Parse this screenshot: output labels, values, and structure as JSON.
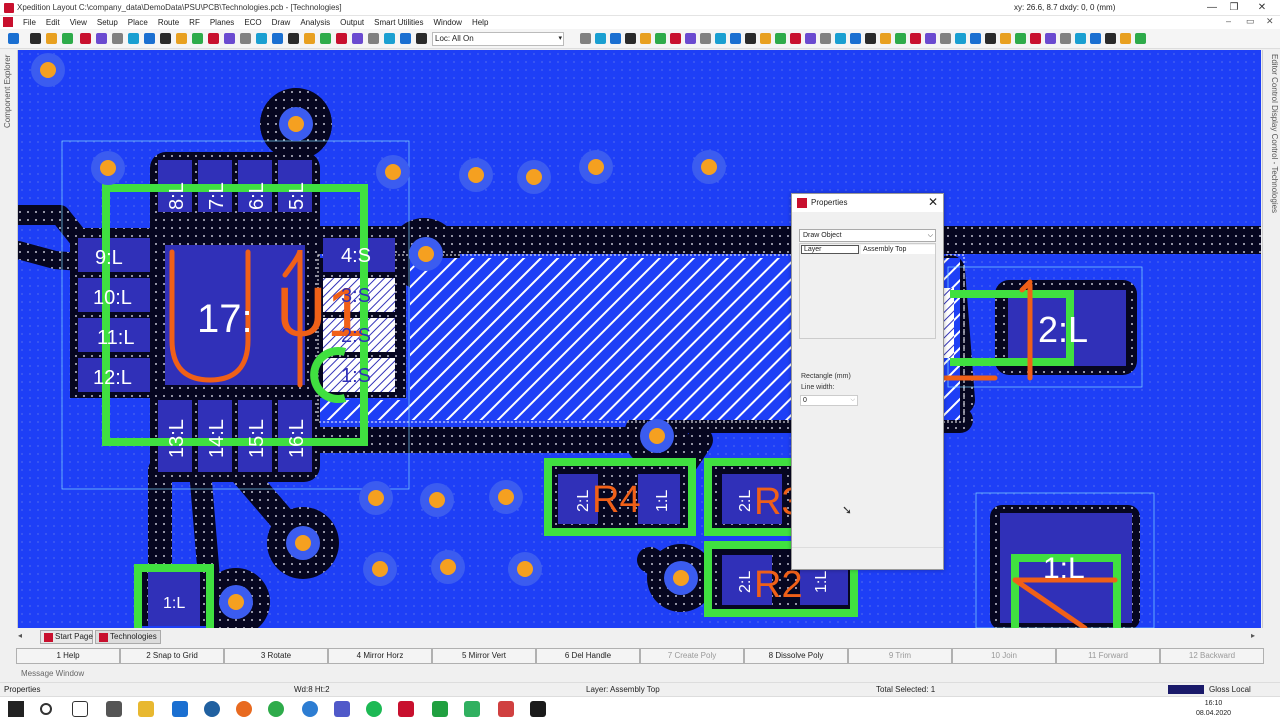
{
  "window": {
    "title": "Xpedition Layout  C:\\company_data\\DemoData\\PSU\\PCB\\Technologies.pcb - [Technologies]",
    "coords": "xy: 26.6, 8.7  dxdy: 0, 0  (mm)",
    "min": "—",
    "max": "❐",
    "close": "✕"
  },
  "menu": [
    "File",
    "Edit",
    "View",
    "Setup",
    "Place",
    "Route",
    "RF",
    "Planes",
    "ECO",
    "Draw",
    "Analysis",
    "Output",
    "Smart Utilities",
    "Window",
    "Help"
  ],
  "mdi": {
    "min": "–",
    "max": "▭",
    "close": "✕"
  },
  "toolbar": {
    "layer_filter": "Loc: All On",
    "arrow": "▾"
  },
  "side": {
    "left": "Component Explorer",
    "right": "Editor Control  Display Control - Technologies"
  },
  "pcb": {
    "components": [
      "17:",
      "U1",
      "8:L",
      "7:L",
      "6:L",
      "5:L",
      "9:L",
      "10:L",
      "11:L",
      "12:L",
      "13:L",
      "14:L",
      "15:L",
      "16:L",
      "4:S",
      "3:S",
      "2:S",
      "1:S",
      "2:L",
      "R4",
      "1:L",
      "2:L",
      "R3",
      "2:L",
      "R2",
      "1:L",
      "2:L",
      "1:L",
      "1:L"
    ]
  },
  "properties": {
    "title": "Properties",
    "close": "✕",
    "object": "Draw Object",
    "arrow": "⌵",
    "row_key": "Layer",
    "row_val": "Assembly Top",
    "section": "Rectangle (mm)",
    "lw_label": "Line width:",
    "lw_val": "0"
  },
  "tabs": {
    "left": "◂",
    "right": "▸",
    "items": [
      "Start Page",
      "Technologies"
    ]
  },
  "fkeys": [
    {
      "label": "1 Help",
      "on": true
    },
    {
      "label": "2 Snap to Grid",
      "on": true
    },
    {
      "label": "3 Rotate",
      "on": true
    },
    {
      "label": "4 Mirror Horz",
      "on": true
    },
    {
      "label": "5 Mirror Vert",
      "on": true
    },
    {
      "label": "6 Del Handle",
      "on": true
    },
    {
      "label": "7 Create Poly",
      "on": false
    },
    {
      "label": "8 Dissolve Poly",
      "on": true
    },
    {
      "label": "9 Trim",
      "on": false
    },
    {
      "label": "10 Join",
      "on": false
    },
    {
      "label": "11 Forward",
      "on": false
    },
    {
      "label": "12 Backward",
      "on": false
    }
  ],
  "message_window": "Message Window",
  "status": {
    "left": "Properties",
    "wd": "Wd:8 Ht:2",
    "layer": "Layer: Assembly Top",
    "selected": "Total Selected: 1",
    "gloss": "Gloss Local"
  },
  "taskbar": {
    "time": "16:10",
    "date": "08.04.2020"
  },
  "colors": {
    "board": "#1e3ff6",
    "pad": "#3030b8",
    "silk": "#40e040",
    "ref": "#f06018",
    "via": "#f5a020",
    "mask": "#0a0a2a"
  }
}
